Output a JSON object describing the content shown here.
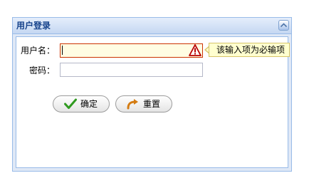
{
  "panel": {
    "title": "用户登录",
    "collapse_icon": "collapse-up-icon"
  },
  "form": {
    "username_label": "用户名：",
    "username_value": "",
    "password_label": "密码：",
    "password_value": "",
    "validation_tip": "该输入项为必输项",
    "warning_icon": "warning-triangle-icon"
  },
  "buttons": {
    "confirm_label": "确定",
    "confirm_icon": "checkmark-icon",
    "reset_label": "重置",
    "reset_icon": "redo-arrow-icon"
  },
  "colors": {
    "panel_border": "#99bbe8",
    "panel_title": "#15428b",
    "invalid_background": "#fffde3",
    "invalid_border": "#cc3300",
    "tip_background": "#ffffcf"
  }
}
